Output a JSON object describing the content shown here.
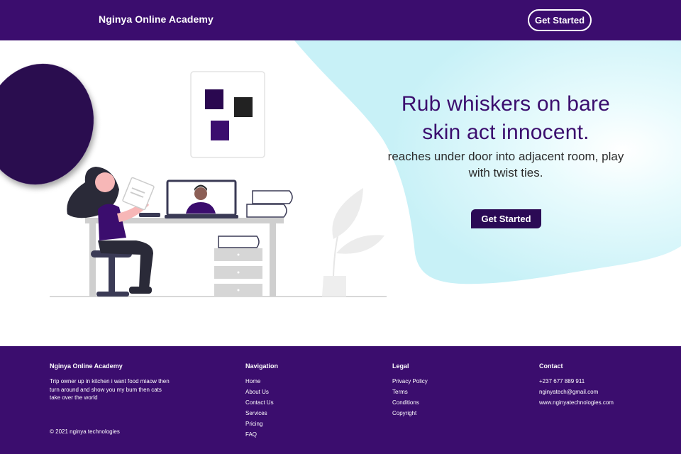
{
  "header": {
    "brand": "Nginya Online Academy",
    "cta_label": "Get Started"
  },
  "hero": {
    "title": "Rub whiskers on bare skin act innocent.",
    "subtitle": "reaches under door into adjacent room, play with twist ties.",
    "cta_label": "Get Started"
  },
  "footer": {
    "about": {
      "title": "Nginya Online Academy",
      "text": "Trip owner up in kitchen i want food miaow then turn around and show you my bum then cats take over the world",
      "copyright": "© 2021 nginya technologies"
    },
    "navigation": {
      "title": "Navigation",
      "items": [
        "Home",
        "About Us",
        "Contact Us",
        "Services",
        "Pricing",
        "FAQ"
      ]
    },
    "legal": {
      "title": "Legal",
      "items": [
        "Privacy Policy",
        "Terms",
        "Conditions",
        "Copyright"
      ]
    },
    "contact": {
      "title": "Contact",
      "items": [
        "+237 677 889 911",
        "nginyatech@gmail.com",
        "www.nginyatechnologies.com"
      ]
    }
  },
  "colors": {
    "brand_purple": "#3b0d6e",
    "dark_button": "#2b0a55",
    "accent_cyan": "#cdf3f8",
    "text_dark": "#2b2b2b"
  },
  "icons": {
    "illustration": "person-working-on-laptop-illustration"
  }
}
